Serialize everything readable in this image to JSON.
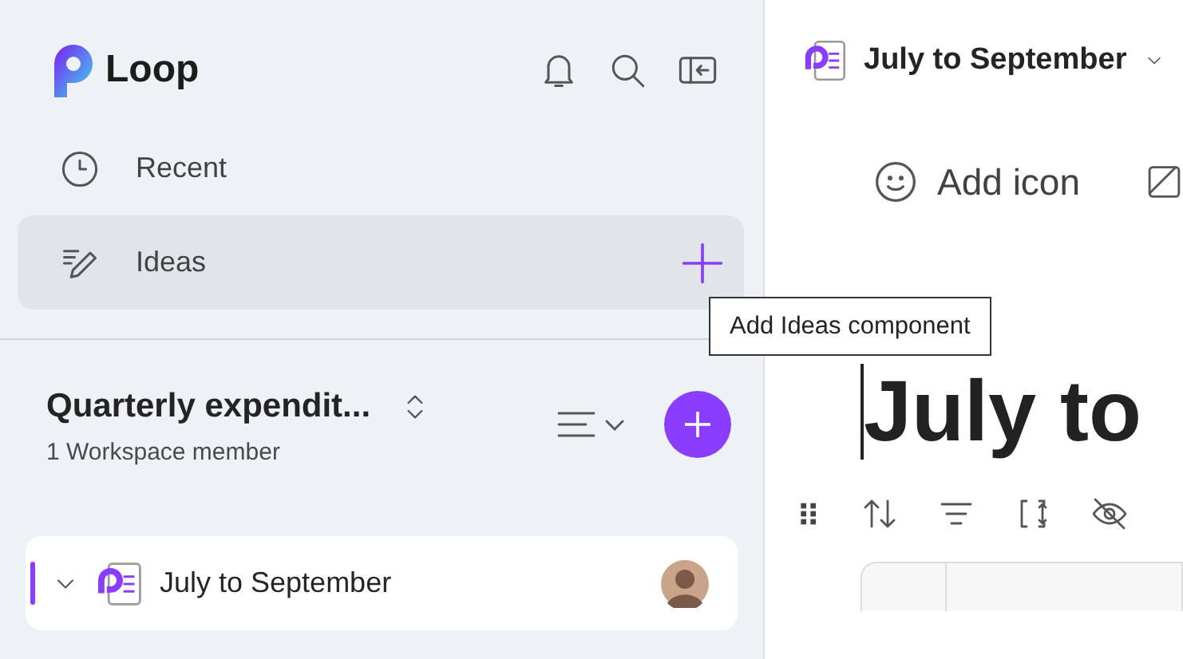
{
  "app": {
    "name": "Loop"
  },
  "nav": [
    {
      "label": "Recent",
      "kind": "recent",
      "selected": false,
      "hovered": false
    },
    {
      "label": "Ideas",
      "kind": "ideas",
      "selected": false,
      "hovered": true
    }
  ],
  "tooltip": {
    "text": "Add Ideas component"
  },
  "workspace": {
    "title": "Quarterly expendit...",
    "members": "1 Workspace member"
  },
  "pages": [
    {
      "title": "July to September",
      "expanded": false,
      "selected": true
    }
  ],
  "page": {
    "breadcrumb": "July to September",
    "add_icon": "Add icon",
    "title": "July to"
  }
}
